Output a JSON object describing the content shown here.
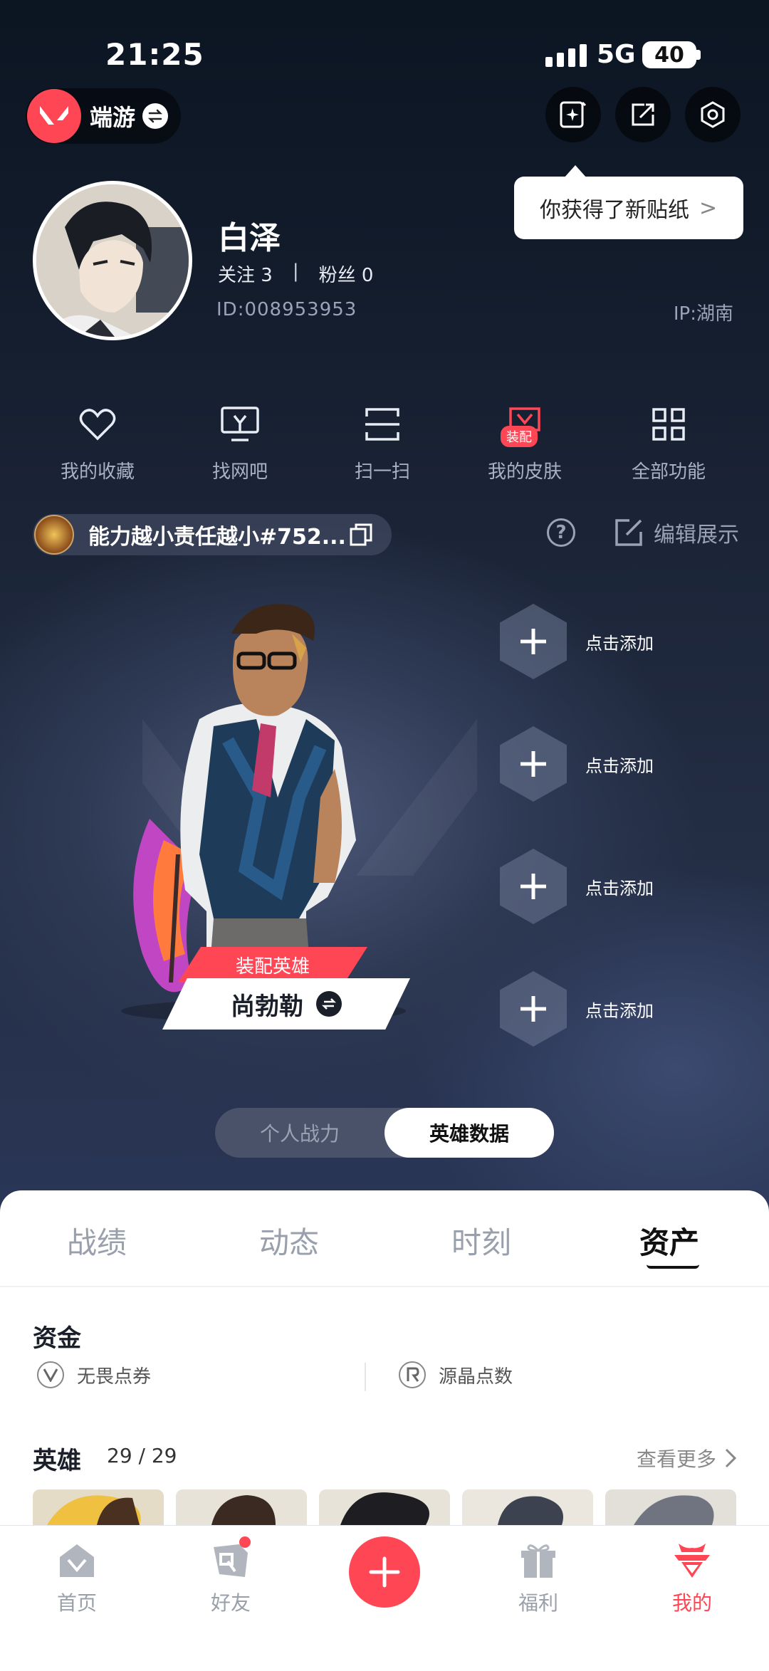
{
  "status_bar": {
    "time": "21:25",
    "network": "5G",
    "battery": "40"
  },
  "header": {
    "app_switch_label": "端游",
    "buttons": [
      "sticker-icon",
      "share-icon",
      "settings-icon"
    ]
  },
  "tooltip": {
    "text": "你获得了新贴纸",
    "chevron": ">"
  },
  "profile": {
    "name": "白泽",
    "following_label": "关注 3",
    "separator": "|",
    "followers_label": "粉丝 0",
    "id": "ID:008953953",
    "ip": "IP:湖南"
  },
  "quick_actions": [
    {
      "label": "我的收藏",
      "icon": "heart-icon"
    },
    {
      "label": "找网吧",
      "icon": "monitor-icon"
    },
    {
      "label": "扫一扫",
      "icon": "scan-icon"
    },
    {
      "label": "我的皮肤",
      "icon": "skin-icon",
      "badge": "装配"
    },
    {
      "label": "全部功能",
      "icon": "grid-icon"
    }
  ],
  "riot_tag": {
    "name": "能力越小责任越小#752..."
  },
  "edit_display": {
    "label": "编辑展示"
  },
  "equipped_agent": {
    "tag": "装配英雄",
    "name": "尚勃勒"
  },
  "add_slots": [
    "点击添加",
    "点击添加",
    "点击添加",
    "点击添加"
  ],
  "segment": {
    "options": [
      "个人战力",
      "英雄数据"
    ],
    "active": 1
  },
  "tabs": {
    "items": [
      "战绩",
      "动态",
      "时刻",
      "资产"
    ],
    "active": 3
  },
  "funds": {
    "title": "资金",
    "items": [
      {
        "label": "无畏点券",
        "icon": "valorant-points-icon"
      },
      {
        "label": "源晶点数",
        "icon": "radianite-points-icon"
      }
    ]
  },
  "heroes": {
    "title": "英雄",
    "count": "29 / 29",
    "see_more": "查看更多"
  },
  "bottom_nav": {
    "items": [
      {
        "label": "首页",
        "icon": "home-icon"
      },
      {
        "label": "好友",
        "icon": "friends-icon",
        "has_dot": true
      },
      {
        "label": "",
        "icon": "plus-icon"
      },
      {
        "label": "福利",
        "icon": "gift-icon"
      },
      {
        "label": "我的",
        "icon": "profile-icon"
      }
    ],
    "active": 4
  },
  "colors": {
    "accent": "#ff4655",
    "bg_dark": "#0f1622",
    "sheet_bg": "#ffffff"
  }
}
